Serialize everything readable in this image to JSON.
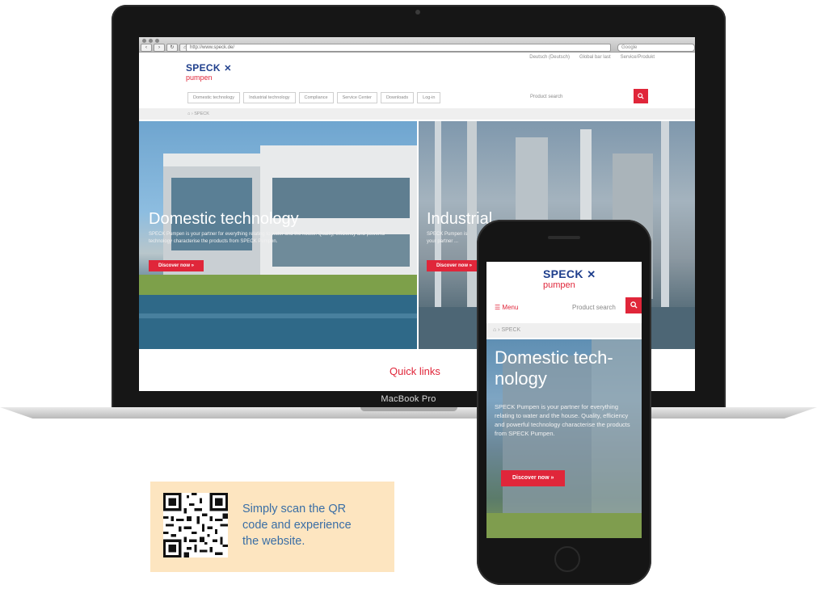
{
  "laptop": {
    "model_label": "MacBook Pro",
    "browser": {
      "url": "http://www.speck.de/",
      "search_placeholder": "Google"
    },
    "site": {
      "logo": {
        "brand": "SPECK",
        "sub": "pumpen"
      },
      "top_links": [
        "Deutsch (Deutsch)",
        "Global bar last",
        "Service/Produkt"
      ],
      "nav": [
        "Domestic technology",
        "Industrial technology",
        "Compliance",
        "Service Center",
        "Downloads",
        "Log-in"
      ],
      "product_search_label": "Product search",
      "search_icon": "search-icon",
      "breadcrumb": "SPECK",
      "hero_left": {
        "title": "Domestic technology",
        "text": "SPECK Pumpen is your partner for everything relating to water and the house. Quality, efficiency and powerful technology characterise the products from SPECK Pumpen.",
        "button": "Discover now »"
      },
      "hero_right": {
        "title": "Industrial",
        "text": "SPECK Pumpen is your partner ...",
        "button": "Discover now »"
      },
      "quick_links": "Quick links"
    }
  },
  "phone": {
    "logo": {
      "brand": "SPECK",
      "sub": "pumpen"
    },
    "menu_label": "Menu",
    "product_search": "Product search",
    "breadcrumb": "SPECK",
    "hero_title_line1": "Domestic tech-",
    "hero_title_line2": "nology",
    "hero_text": "SPECK Pumpen is your partner for everything relating to water and the house. Quality, efficiency and powerful technology characterise the products from SPECK Pumpen.",
    "hero_button": "Discover now »"
  },
  "qr_panel": {
    "caption_line1": "Simply scan the QR",
    "caption_line2": "code and experience",
    "caption_line3": "the website."
  },
  "colors": {
    "brand_blue": "#1e3e8c",
    "brand_red": "#e0263a",
    "panel_bg": "#fde5c0",
    "caption": "#3a6ea5"
  }
}
